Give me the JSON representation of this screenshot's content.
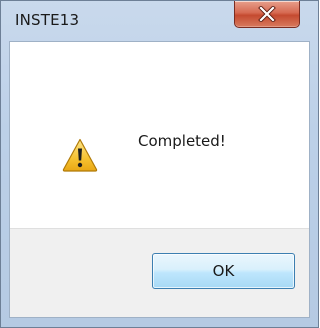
{
  "window": {
    "title": "INSTE13"
  },
  "dialog": {
    "icon": "warning-icon",
    "message": "Completed!"
  },
  "buttons": {
    "ok_label": "OK",
    "close_icon": "close-icon"
  },
  "colors": {
    "close_button": "#d66a52",
    "warning_fill": "#f6c231",
    "ok_border": "#3c7fb1"
  }
}
